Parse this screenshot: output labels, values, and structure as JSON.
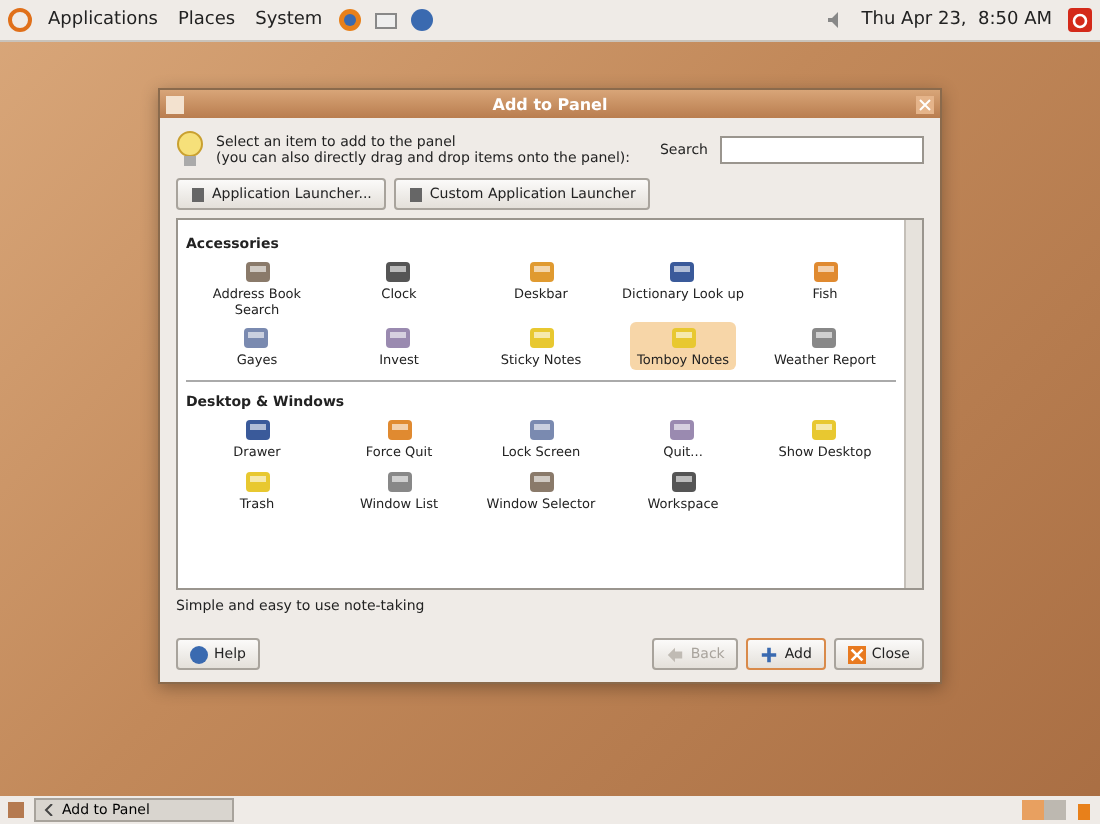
{
  "top_panel": {
    "menus": [
      "Applications",
      "Places",
      "System"
    ],
    "clock": "Thu Apr 23,  8:50 AM"
  },
  "dialog": {
    "title": "Add to Panel",
    "intro": [
      "Select an item to add to the panel",
      "(you can also directly drag and drop items onto the panel):"
    ],
    "search": {
      "label": "Search"
    },
    "launcher_buttons": [
      "Application Launcher...",
      "Custom Application Launcher"
    ],
    "sections": [
      {
        "title": "Accessories",
        "items": [
          {
            "label": "Address Book Search",
            "selected": false
          },
          {
            "label": "Clock",
            "selected": false
          },
          {
            "label": "Deskbar",
            "selected": false
          },
          {
            "label": "Dictionary Look up",
            "selected": false
          },
          {
            "label": "Fish",
            "selected": false
          },
          {
            "label": "Gayes",
            "selected": false
          },
          {
            "label": "Invest",
            "selected": false
          },
          {
            "label": "Sticky Notes",
            "selected": false
          },
          {
            "label": "Tomboy Notes",
            "selected": true
          },
          {
            "label": "Weather Report",
            "selected": false
          }
        ]
      },
      {
        "title": "Desktop & Windows",
        "items": [
          {
            "label": "Drawer",
            "selected": false
          },
          {
            "label": "Force Quit",
            "selected": false
          },
          {
            "label": "Lock Screen",
            "selected": false
          },
          {
            "label": "Quit...",
            "selected": false
          },
          {
            "label": "Show Desktop",
            "selected": false
          },
          {
            "label": "Trash",
            "selected": false
          },
          {
            "label": "Window List",
            "selected": false
          },
          {
            "label": "Window Selector",
            "selected": false
          },
          {
            "label": "Workspace",
            "selected": false
          }
        ]
      }
    ],
    "description": "Simple and easy to use note-taking",
    "help": "Help",
    "buttons": [
      {
        "kind": "back",
        "label": "Back",
        "disabled": true
      },
      {
        "kind": "add",
        "label": "Add",
        "disabled": false
      },
      {
        "kind": "close",
        "label": "Close",
        "disabled": false
      }
    ]
  },
  "bottom_panel": {
    "task": "Add to Panel"
  }
}
